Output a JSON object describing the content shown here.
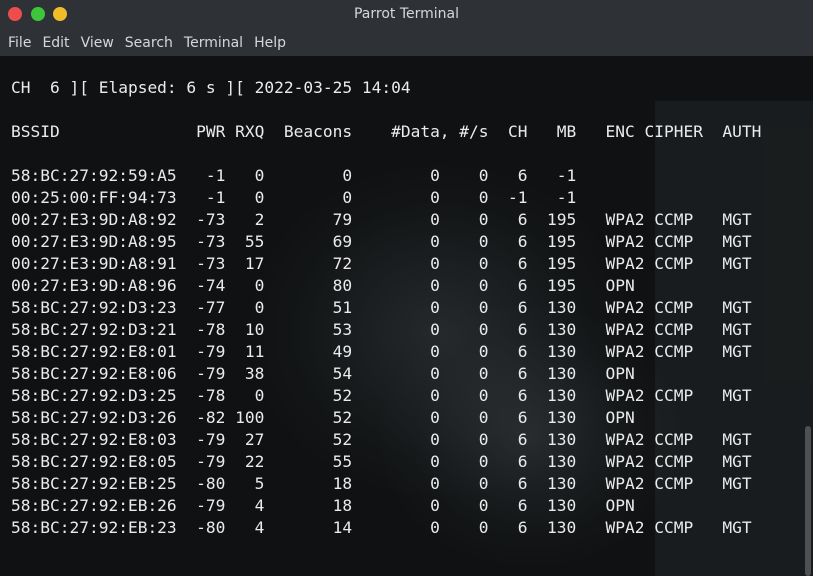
{
  "window": {
    "title": "Parrot Terminal"
  },
  "menu": {
    "items": [
      {
        "label": "File"
      },
      {
        "label": "Edit"
      },
      {
        "label": "View"
      },
      {
        "label": "Search"
      },
      {
        "label": "Terminal"
      },
      {
        "label": "Help"
      }
    ]
  },
  "terminal": {
    "status_line": "CH  6 ][ Elapsed: 6 s ][ 2022-03-25 14:04",
    "table_header": "BSSID              PWR RXQ  Beacons    #Data, #/s  CH   MB   ENC CIPHER  AUTH",
    "rows": [
      "58:BC:27:92:59:A5   -1   0        0        0    0   6   -1",
      "00:25:00:FF:94:73   -1   0        0        0    0  -1   -1",
      "00:27:E3:9D:A8:92  -73   2       79        0    0   6  195   WPA2 CCMP   MGT",
      "00:27:E3:9D:A8:95  -73  55       69        0    0   6  195   WPA2 CCMP   MGT",
      "00:27:E3:9D:A8:91  -73  17       72        0    0   6  195   WPA2 CCMP   MGT",
      "00:27:E3:9D:A8:96  -74   0       80        0    0   6  195   OPN",
      "58:BC:27:92:D3:23  -77   0       51        0    0   6  130   WPA2 CCMP   MGT",
      "58:BC:27:92:D3:21  -78  10       53        0    0   6  130   WPA2 CCMP   MGT",
      "58:BC:27:92:E8:01  -79  11       49        0    0   6  130   WPA2 CCMP   MGT",
      "58:BC:27:92:E8:06  -79  38       54        0    0   6  130   OPN",
      "58:BC:27:92:D3:25  -78   0       52        0    0   6  130   WPA2 CCMP   MGT",
      "58:BC:27:92:D3:26  -82 100       52        0    0   6  130   OPN",
      "58:BC:27:92:E8:03  -79  27       52        0    0   6  130   WPA2 CCMP   MGT",
      "58:BC:27:92:E8:05  -79  22       55        0    0   6  130   WPA2 CCMP   MGT",
      "58:BC:27:92:EB:25  -80   5       18        0    0   6  130   WPA2 CCMP   MGT",
      "58:BC:27:92:EB:26  -79   4       18        0    0   6  130   OPN",
      "58:BC:27:92:EB:23  -80   4       14        0    0   6  130   WPA2 CCMP   MGT"
    ]
  },
  "colors": {
    "titlebar_bg": "#2e3237",
    "terminal_bg": "#0f1112",
    "terminal_fg": "#e9ebed",
    "close": "#ee4d4d",
    "minimize": "#3fc53a",
    "maximize": "#f0bd2a"
  }
}
